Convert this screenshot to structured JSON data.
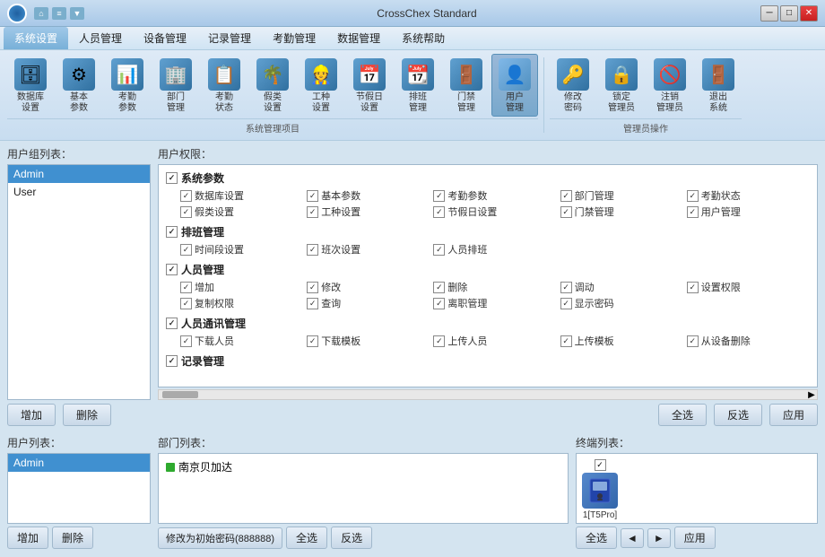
{
  "titlebar": {
    "title": "CrossChex Standard",
    "minimize_label": "─",
    "maximize_label": "□",
    "close_label": "✕"
  },
  "menubar": {
    "items": [
      "系统设置",
      "人员管理",
      "设备管理",
      "记录管理",
      "考勤管理",
      "数据管理",
      "系统帮助"
    ],
    "active": "系统设置"
  },
  "toolbar": {
    "groups": [
      {
        "label": "系统管理项目",
        "items": [
          {
            "icon": "🗄",
            "label": "数据库\n设置",
            "name": "db-settings"
          },
          {
            "icon": "⚙",
            "label": "基本\n参数",
            "name": "basic-params"
          },
          {
            "icon": "📊",
            "label": "考勤\n参数",
            "name": "attendance-params"
          },
          {
            "icon": "🏢",
            "label": "部门\n管理",
            "name": "dept-management"
          },
          {
            "icon": "📋",
            "label": "考勤\n状态",
            "name": "attendance-status"
          },
          {
            "icon": "🌴",
            "label": "假类\n设置",
            "name": "leave-settings"
          },
          {
            "icon": "👷",
            "label": "工种\n设置",
            "name": "work-type"
          },
          {
            "icon": "📅",
            "label": "节假日\n设置",
            "name": "holiday-settings"
          },
          {
            "icon": "📆",
            "label": "排班\n管理",
            "name": "shift-management"
          },
          {
            "icon": "🚪",
            "label": "门禁\n管理",
            "name": "door-management"
          },
          {
            "icon": "👤",
            "label": "用户\n管理",
            "name": "user-management",
            "active": true
          }
        ]
      },
      {
        "label": "管理员操作",
        "items": [
          {
            "icon": "🔑",
            "label": "修改\n密码",
            "name": "change-password"
          },
          {
            "icon": "🔒",
            "label": "锁定\n管理员",
            "name": "lock-admin"
          },
          {
            "icon": "🚫",
            "label": "注销\n管理员",
            "name": "logout-admin"
          },
          {
            "icon": "🚪",
            "label": "退出\n系统",
            "name": "exit-system"
          }
        ]
      }
    ]
  },
  "top_section": {
    "user_group_label": "用户组列表：",
    "permissions_label": "用户权限：",
    "user_groups": [
      "Admin",
      "User"
    ],
    "selected_group": "Admin",
    "permissions": {
      "sections": [
        {
          "title": "系统参数",
          "checked": true,
          "items": [
            {
              "label": "数据库设置",
              "checked": true
            },
            {
              "label": "基本参数",
              "checked": true
            },
            {
              "label": "考勤参数",
              "checked": true
            },
            {
              "label": "部门管理",
              "checked": true
            },
            {
              "label": "考勤状态",
              "checked": true
            },
            {
              "label": "假类设置",
              "checked": true
            },
            {
              "label": "工种设置",
              "checked": true
            },
            {
              "label": "节假日设置",
              "checked": true
            },
            {
              "label": "门禁管理",
              "checked": true
            },
            {
              "label": "用户管理",
              "checked": true
            }
          ]
        },
        {
          "title": "排班管理",
          "checked": true,
          "items": [
            {
              "label": "时间段设置",
              "checked": true
            },
            {
              "label": "班次设置",
              "checked": true
            },
            {
              "label": "人员排班",
              "checked": true
            }
          ]
        },
        {
          "title": "人员管理",
          "checked": true,
          "items": [
            {
              "label": "增加",
              "checked": true
            },
            {
              "label": "修改",
              "checked": true
            },
            {
              "label": "删除",
              "checked": true
            },
            {
              "label": "调动",
              "checked": true
            },
            {
              "label": "设置权限",
              "checked": true
            },
            {
              "label": "复制权限",
              "checked": true
            },
            {
              "label": "查询",
              "checked": true
            },
            {
              "label": "离职管理",
              "checked": true
            },
            {
              "label": "显示密码",
              "checked": true
            }
          ]
        },
        {
          "title": "人员通讯管理",
          "checked": true,
          "items": [
            {
              "label": "下载人员",
              "checked": true
            },
            {
              "label": "下载模板",
              "checked": true
            },
            {
              "label": "上传人员",
              "checked": true
            },
            {
              "label": "上传模板",
              "checked": true
            },
            {
              "label": "从设备删除",
              "checked": true
            }
          ]
        },
        {
          "title": "记录管理",
          "checked": true,
          "items": []
        }
      ]
    }
  },
  "buttons_top": {
    "add": "增加",
    "delete": "删除",
    "select_all": "全选",
    "invert": "反选",
    "apply": "应用"
  },
  "bottom_section": {
    "user_list_label": "用户列表：",
    "dept_list_label": "部门列表：",
    "terminal_list_label": "终端列表：",
    "users": [
      "Admin"
    ],
    "selected_user": "Admin",
    "departments": [
      {
        "name": "南京贝加达",
        "icon": "green"
      }
    ],
    "terminals": [
      {
        "id": "1",
        "name": "T5Pro",
        "label": "1[T5Pro]",
        "checked": true
      }
    ]
  },
  "buttons_bottom": {
    "add": "增加",
    "delete": "删除",
    "reset_password": "修改为初始密码(888888)",
    "select_all": "全选",
    "invert": "反选",
    "terminal_select_all": "全选",
    "terminal_prev": "◄",
    "terminal_next": "►",
    "terminal_apply": "应用"
  }
}
